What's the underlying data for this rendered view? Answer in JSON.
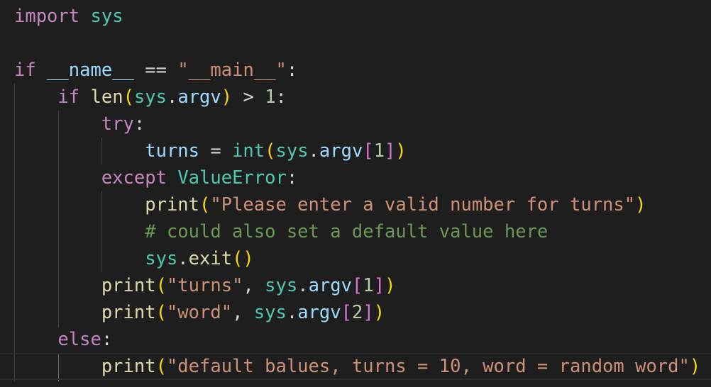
{
  "editor": {
    "lines": [
      {
        "tokens": [
          {
            "t": "import",
            "c": "kw-ctrl"
          },
          {
            "t": " ",
            "c": ""
          },
          {
            "t": "sys",
            "c": "mod"
          }
        ]
      },
      {
        "tokens": []
      },
      {
        "tokens": [
          {
            "t": "if",
            "c": "kw-ctrl"
          },
          {
            "t": " ",
            "c": ""
          },
          {
            "t": "__name__",
            "c": "var"
          },
          {
            "t": " == ",
            "c": "op"
          },
          {
            "t": "\"__main__\"",
            "c": "str"
          },
          {
            "t": ":",
            "c": "op"
          }
        ]
      },
      {
        "tokens": [
          {
            "t": "    ",
            "c": ""
          },
          {
            "t": "if",
            "c": "kw-ctrl"
          },
          {
            "t": " ",
            "c": ""
          },
          {
            "t": "len",
            "c": "fn"
          },
          {
            "t": "(",
            "c": "p1"
          },
          {
            "t": "sys",
            "c": "mod"
          },
          {
            "t": ".",
            "c": "op"
          },
          {
            "t": "argv",
            "c": "var"
          },
          {
            "t": ")",
            "c": "p1"
          },
          {
            "t": " > ",
            "c": "op"
          },
          {
            "t": "1",
            "c": "num"
          },
          {
            "t": ":",
            "c": "op"
          }
        ]
      },
      {
        "tokens": [
          {
            "t": "        ",
            "c": ""
          },
          {
            "t": "try",
            "c": "kw-ctrl"
          },
          {
            "t": ":",
            "c": "op"
          }
        ]
      },
      {
        "tokens": [
          {
            "t": "            ",
            "c": ""
          },
          {
            "t": "turns",
            "c": "var"
          },
          {
            "t": " = ",
            "c": "op"
          },
          {
            "t": "int",
            "c": "cls"
          },
          {
            "t": "(",
            "c": "p1"
          },
          {
            "t": "sys",
            "c": "mod"
          },
          {
            "t": ".",
            "c": "op"
          },
          {
            "t": "argv",
            "c": "var"
          },
          {
            "t": "[",
            "c": "p2"
          },
          {
            "t": "1",
            "c": "num"
          },
          {
            "t": "]",
            "c": "p2"
          },
          {
            "t": ")",
            "c": "p1"
          }
        ]
      },
      {
        "tokens": [
          {
            "t": "        ",
            "c": ""
          },
          {
            "t": "except",
            "c": "kw-ctrl"
          },
          {
            "t": " ",
            "c": ""
          },
          {
            "t": "ValueError",
            "c": "cls"
          },
          {
            "t": ":",
            "c": "op"
          }
        ]
      },
      {
        "tokens": [
          {
            "t": "            ",
            "c": ""
          },
          {
            "t": "print",
            "c": "fn"
          },
          {
            "t": "(",
            "c": "p1"
          },
          {
            "t": "\"Please enter a valid number for turns\"",
            "c": "str"
          },
          {
            "t": ")",
            "c": "p1"
          }
        ]
      },
      {
        "tokens": [
          {
            "t": "            ",
            "c": ""
          },
          {
            "t": "# could also set a default value here",
            "c": "cmt"
          }
        ]
      },
      {
        "tokens": [
          {
            "t": "            ",
            "c": ""
          },
          {
            "t": "sys",
            "c": "mod"
          },
          {
            "t": ".",
            "c": "op"
          },
          {
            "t": "exit",
            "c": "fn"
          },
          {
            "t": "()",
            "c": "p1"
          }
        ]
      },
      {
        "tokens": [
          {
            "t": "        ",
            "c": ""
          },
          {
            "t": "print",
            "c": "fn"
          },
          {
            "t": "(",
            "c": "p1"
          },
          {
            "t": "\"turns\"",
            "c": "str"
          },
          {
            "t": ", ",
            "c": "op"
          },
          {
            "t": "sys",
            "c": "mod"
          },
          {
            "t": ".",
            "c": "op"
          },
          {
            "t": "argv",
            "c": "var"
          },
          {
            "t": "[",
            "c": "p2"
          },
          {
            "t": "1",
            "c": "num"
          },
          {
            "t": "]",
            "c": "p2"
          },
          {
            "t": ")",
            "c": "p1"
          }
        ]
      },
      {
        "tokens": [
          {
            "t": "        ",
            "c": ""
          },
          {
            "t": "print",
            "c": "fn"
          },
          {
            "t": "(",
            "c": "p1"
          },
          {
            "t": "\"word\"",
            "c": "str"
          },
          {
            "t": ", ",
            "c": "op"
          },
          {
            "t": "sys",
            "c": "mod"
          },
          {
            "t": ".",
            "c": "op"
          },
          {
            "t": "argv",
            "c": "var"
          },
          {
            "t": "[",
            "c": "p2"
          },
          {
            "t": "2",
            "c": "num"
          },
          {
            "t": "]",
            "c": "p2"
          },
          {
            "t": ")",
            "c": "p1"
          }
        ]
      },
      {
        "tokens": [
          {
            "t": "    ",
            "c": ""
          },
          {
            "t": "else",
            "c": "kw-ctrl"
          },
          {
            "t": ":",
            "c": "op"
          }
        ]
      },
      {
        "tokens": [
          {
            "t": "        ",
            "c": ""
          },
          {
            "t": "print",
            "c": "fn"
          },
          {
            "t": "(",
            "c": "p1"
          },
          {
            "t": "\"default balues, turns = 10, word = random word\"",
            "c": "str"
          },
          {
            "t": ")",
            "c": "p1"
          }
        ]
      }
    ],
    "current_line_index": 13,
    "colors": {
      "background": "#1e1e1e",
      "keyword_control": "#c586c0",
      "function": "#dcdcaa",
      "variable": "#9cdcfe",
      "type": "#4ec9b0",
      "string": "#ce9178",
      "number": "#b5cea8",
      "comment": "#6a9955",
      "bracket_level_1": "#ffd700",
      "bracket_level_2": "#da70d6"
    }
  }
}
